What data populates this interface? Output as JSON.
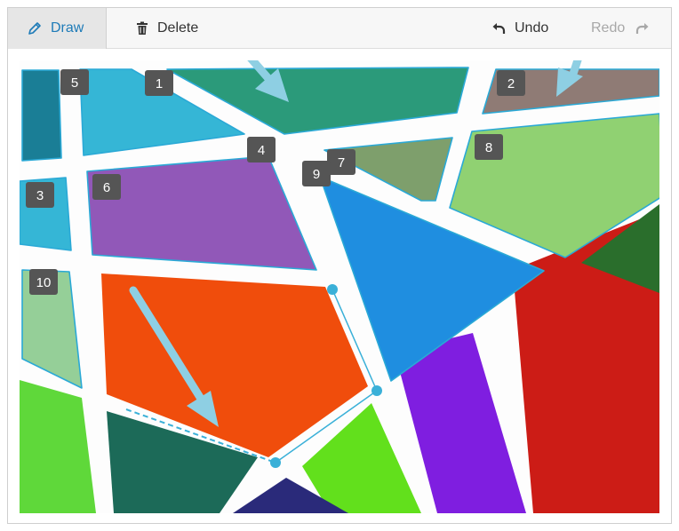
{
  "toolbar": {
    "draw_label": "Draw",
    "delete_label": "Delete",
    "undo_label": "Undo",
    "redo_label": "Redo"
  },
  "icons": {
    "draw": "pencil-icon",
    "delete": "trash-icon",
    "undo": "undo-arrow-icon",
    "redo": "redo-arrow-icon"
  },
  "colors": {
    "active_tool": "#1e7bb8",
    "region_outline": "#2aa9d6",
    "marker": "#3ab0d8",
    "badge": "#555555",
    "hint_arrow": "#8ecfe3"
  },
  "regions": [
    {
      "label": "1",
      "fill": "#2b9a7a"
    },
    {
      "label": "2",
      "fill": "#8f7b75"
    },
    {
      "label": "3",
      "fill": "#35b6d6"
    },
    {
      "label": "4",
      "fill": ""
    },
    {
      "label": "5",
      "fill": "#1a7e96"
    },
    {
      "label": "6",
      "fill": "#9158b8"
    },
    {
      "label": "7",
      "fill": "#7e9f6c"
    },
    {
      "label": "8",
      "fill": "#90d172"
    },
    {
      "label": "9",
      "fill": "#1f8ee0"
    },
    {
      "label": "10",
      "fill": "#95cf98"
    }
  ]
}
